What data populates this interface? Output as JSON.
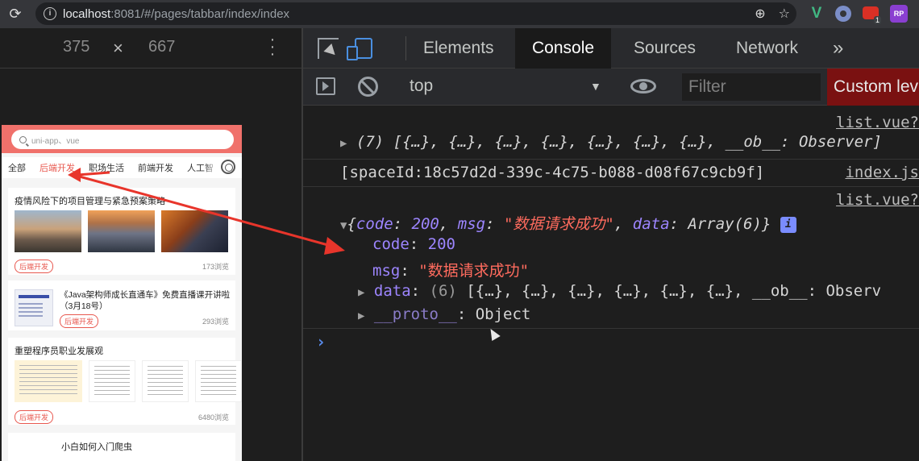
{
  "browser": {
    "url_host": "localhost",
    "url_rest": ":8081/#/pages/tabbar/index/index",
    "extension_badge": "1",
    "ext_rp": "RP",
    "ext_v": "V"
  },
  "device_toolbar": {
    "width": "375",
    "height": "667",
    "times": "×"
  },
  "phone": {
    "search_placeholder": "uni-app、vue",
    "tabs": [
      "全部",
      "后端开发",
      "职场生活",
      "前端开发",
      "人工智"
    ],
    "cards": [
      {
        "title": "疫情风险下的项目管理与紧急预案策略",
        "tag": "后端开发",
        "views": "173浏览"
      },
      {
        "title": "《Java架构师成长直通车》免费直播课开讲啦（3月18号）",
        "tag": "后端开发",
        "views": "293浏览"
      },
      {
        "title": "重塑程序员职业发展观",
        "tag": "后端开发",
        "views": "6480浏览"
      },
      {
        "title": "小白如何入门爬虫"
      }
    ]
  },
  "devtools": {
    "tabs": [
      "Elements",
      "Console",
      "Sources",
      "Network"
    ],
    "active_tab": "Console",
    "more": "»",
    "context": "top",
    "filter_placeholder": "Filter",
    "levels": "Custom lev",
    "console": {
      "src1": "list.vue?",
      "log1": "(7) [{…}, {…}, {…}, {…}, {…}, {…}, {…}, __ob__: Observer]",
      "log2": "[spaceId:18c57d2d-339c-4c75-b088-d08f67c9cb9f]",
      "src2": "index.js",
      "src3": "list.vue?",
      "obj_open": "{",
      "obj_code_key": "code",
      "obj_code_val": "200",
      "obj_msg_key": "msg",
      "obj_msg_val": "\"数据请求成功\"",
      "obj_data_key": "data",
      "obj_data_val": "Array(6)",
      "obj_close": "}",
      "info": "i",
      "code_key": "code",
      "code_val": "200",
      "msg_key": "msg",
      "msg_val": "\"数据请求成功\"",
      "data_key": "data",
      "data_count": "(6)",
      "data_val": "[{…}, {…}, {…}, {…}, {…}, {…}, __ob__: Observ",
      "proto_key": "__proto__",
      "proto_val": "Object"
    }
  },
  "colors": {
    "accent_red": "#f0716b",
    "tag_red": "#e8584f",
    "console_purple": "#9d85ff",
    "console_string": "#ff6b5e"
  }
}
